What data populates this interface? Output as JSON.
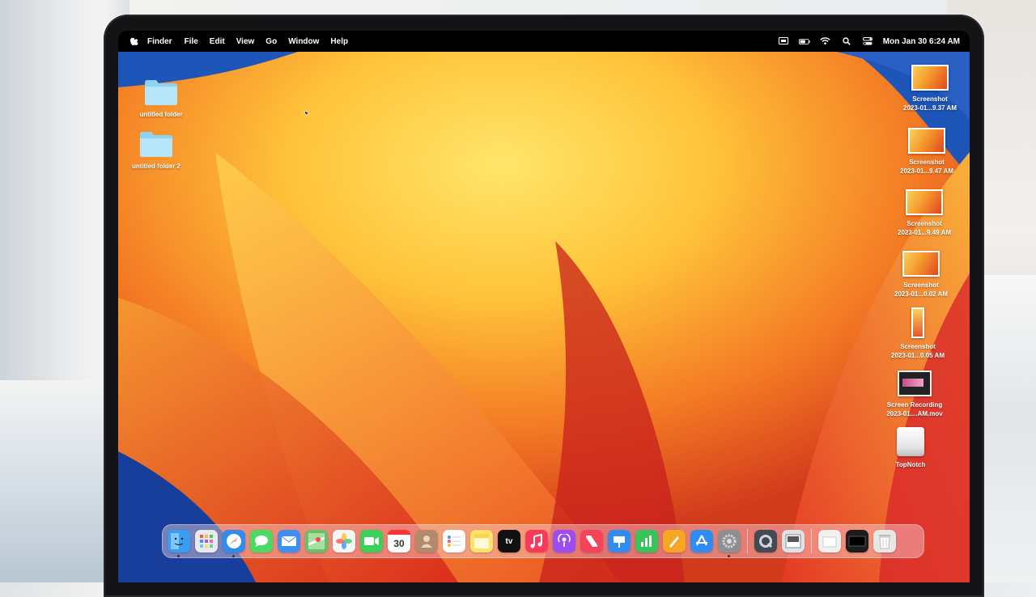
{
  "menubar": {
    "apple_icon": "apple-icon",
    "app_name": "Finder",
    "items": [
      "File",
      "Edit",
      "View",
      "Go",
      "Window",
      "Help"
    ],
    "clock": "Mon Jan 30  6:24 AM",
    "status_icons": [
      "screen-mirroring-icon",
      "battery-icon",
      "wifi-icon",
      "search-icon",
      "control-center-icon"
    ]
  },
  "desktop": {
    "left_items": [
      {
        "label": "untitled folder",
        "icon": "folder-icon"
      },
      {
        "label": "untitled folder 2",
        "icon": "folder-icon"
      }
    ],
    "right_items": [
      {
        "label1": "Screenshot",
        "label2": "2023-01...9.37 AM",
        "icon": "screenshot-thumbnail"
      },
      {
        "label1": "Screenshot",
        "label2": "2023-01...9.47 AM",
        "icon": "screenshot-thumbnail"
      },
      {
        "label1": "Screenshot",
        "label2": "2023-01...9.49 AM",
        "icon": "screenshot-thumbnail"
      },
      {
        "label1": "Screenshot",
        "label2": "2023-01...0.02 AM",
        "icon": "screenshot-thumbnail"
      },
      {
        "label1": "Screenshot",
        "label2": "2023-01...0.05 AM",
        "icon": "screenshot-tall-thumbnail"
      },
      {
        "label1": "Screen Recording",
        "label2": "2023-01....AM.mov",
        "icon": "screen-recording-thumbnail"
      },
      {
        "label1": "TopNotch",
        "label2": "",
        "icon": "drive-icon"
      }
    ]
  },
  "dock": {
    "apps": [
      {
        "name": "finder",
        "color": "#3a9cf2"
      },
      {
        "name": "launchpad",
        "color": "#e9e9ee"
      },
      {
        "name": "safari",
        "color": "#2f8cf0"
      },
      {
        "name": "messages",
        "color": "#4cd964"
      },
      {
        "name": "mail",
        "color": "#3d8ef5"
      },
      {
        "name": "maps",
        "color": "#67c06b"
      },
      {
        "name": "photos",
        "color": "#f6f6f6"
      },
      {
        "name": "facetime",
        "color": "#3ccf5a"
      },
      {
        "name": "calendar",
        "color": "#ffffff"
      },
      {
        "name": "contacts",
        "color": "#b08a6a"
      },
      {
        "name": "reminders",
        "color": "#ffffff"
      },
      {
        "name": "notes",
        "color": "#fde36a"
      },
      {
        "name": "tv",
        "color": "#111111"
      },
      {
        "name": "music",
        "color": "#fa3a5a"
      },
      {
        "name": "podcasts",
        "color": "#9b4cf3"
      },
      {
        "name": "news",
        "color": "#f5445a"
      },
      {
        "name": "keynote",
        "color": "#2f8df2"
      },
      {
        "name": "numbers",
        "color": "#37c55a"
      },
      {
        "name": "pages",
        "color": "#f6a623"
      },
      {
        "name": "app-store",
        "color": "#2f8cf2"
      },
      {
        "name": "system-settings",
        "color": "#8e8e93"
      }
    ],
    "tv_label": "tv",
    "calendar_day": "30",
    "extras": [
      {
        "name": "quicktime",
        "color": "#444a55"
      },
      {
        "name": "preview",
        "color": "#dfe3e8"
      }
    ],
    "trash": [
      {
        "name": "downloads-stack",
        "color": "#f1f1f1"
      },
      {
        "name": "recent-window",
        "color": "#1c1c1c"
      },
      {
        "name": "trash",
        "color": "#e7e7e7"
      }
    ]
  }
}
